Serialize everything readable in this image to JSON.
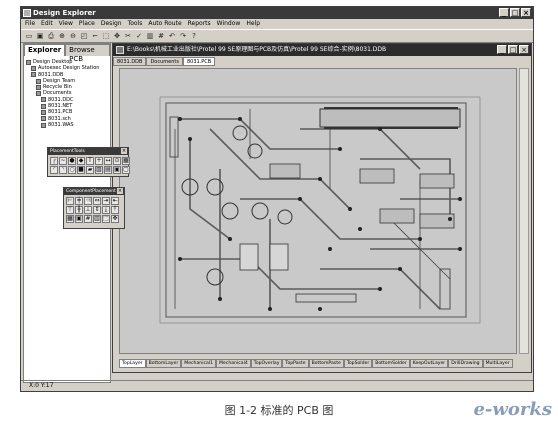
{
  "app": {
    "title": "Design Explorer"
  },
  "menu": [
    "File",
    "Edit",
    "View",
    "Place",
    "Design",
    "Tools",
    "Auto Route",
    "Reports",
    "Window",
    "Help"
  ],
  "toolbar_icons": [
    "open-icon",
    "save-icon",
    "print-icon",
    "zoom-in-icon",
    "zoom-out-icon",
    "zoom-fit-icon",
    "route-icon",
    "select-icon",
    "move-icon",
    "cut-icon",
    "check-icon",
    "library-icon",
    "grid-icon",
    "undo-icon",
    "redo-icon",
    "help-icon"
  ],
  "panel": {
    "tabs": [
      "Explorer",
      "Browse PCB"
    ],
    "tree": [
      "Design Desktop",
      "Autoexec Design Station",
      "8031.DDB",
      "Design Team",
      "Recycle Bin",
      "Documents",
      "8031.DDC",
      "8031.NET",
      "8031.PCB",
      "8031.sch",
      "8031.WAS"
    ]
  },
  "document": {
    "title": "E:\\Books\\机械工业出版社\\Protel 99 SE原理图与PCB及仿真\\Protel 99 SE综合-实例\\8031.DDB",
    "tabs": [
      "8031.DDB",
      "Documents",
      "8031.PCB"
    ],
    "layers": [
      "TopLayer",
      "BottomLayer",
      "Mechanical1",
      "Mechanical4",
      "TopOverlay",
      "TopPaste",
      "BottomPaste",
      "TopSolder",
      "BottomSolder",
      "KeepOutLayer",
      "DrillDrawing",
      "MultiLayer"
    ]
  },
  "floating": {
    "placement_tools": {
      "title": "PlacementTools"
    },
    "component_placement": {
      "title": "ComponentPlacement"
    }
  },
  "status": {
    "coords": "X:0 Y:17"
  },
  "caption": "图 1-2   标准的 PCB 图",
  "watermark": "e-works"
}
